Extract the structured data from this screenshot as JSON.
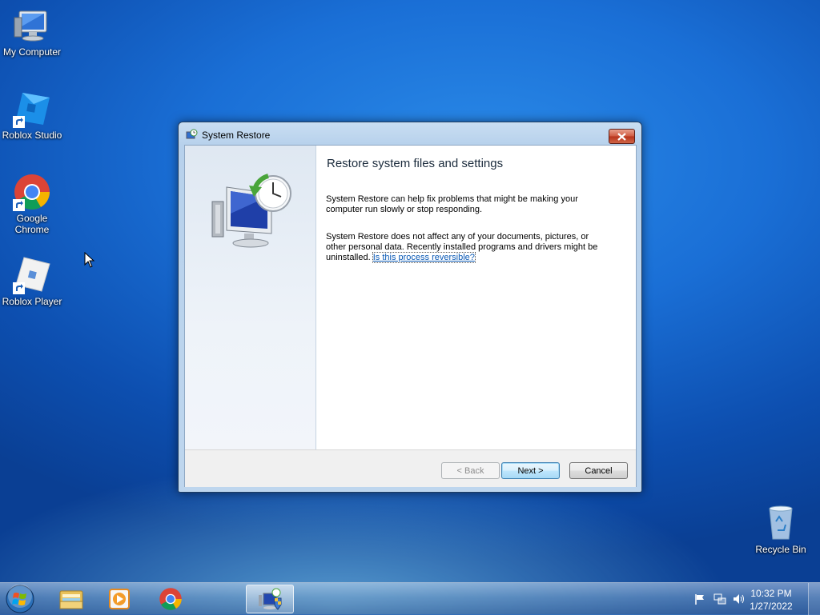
{
  "desktop": {
    "icons": [
      {
        "label": "My Computer"
      },
      {
        "label": "Roblox Studio"
      },
      {
        "label": "Google Chrome"
      },
      {
        "label": "Roblox Player"
      },
      {
        "label": "Recycle Bin"
      }
    ]
  },
  "window": {
    "title": "System Restore",
    "heading": "Restore system files and settings",
    "para1": "System Restore can help fix problems that might be making your computer run slowly or stop responding.",
    "para2": "System Restore does not affect any of your documents, pictures, or other personal data. Recently installed programs and drivers might be uninstalled.",
    "link": "Is this process reversible?",
    "buttons": {
      "back": "< Back",
      "next": "Next >",
      "cancel": "Cancel"
    }
  },
  "taskbar": {
    "clock_time": "10:32 PM",
    "clock_date": "1/27/2022"
  },
  "colors": {
    "accent": "#1a6fd6",
    "link": "#0a59b5",
    "close": "#cf5a40"
  }
}
